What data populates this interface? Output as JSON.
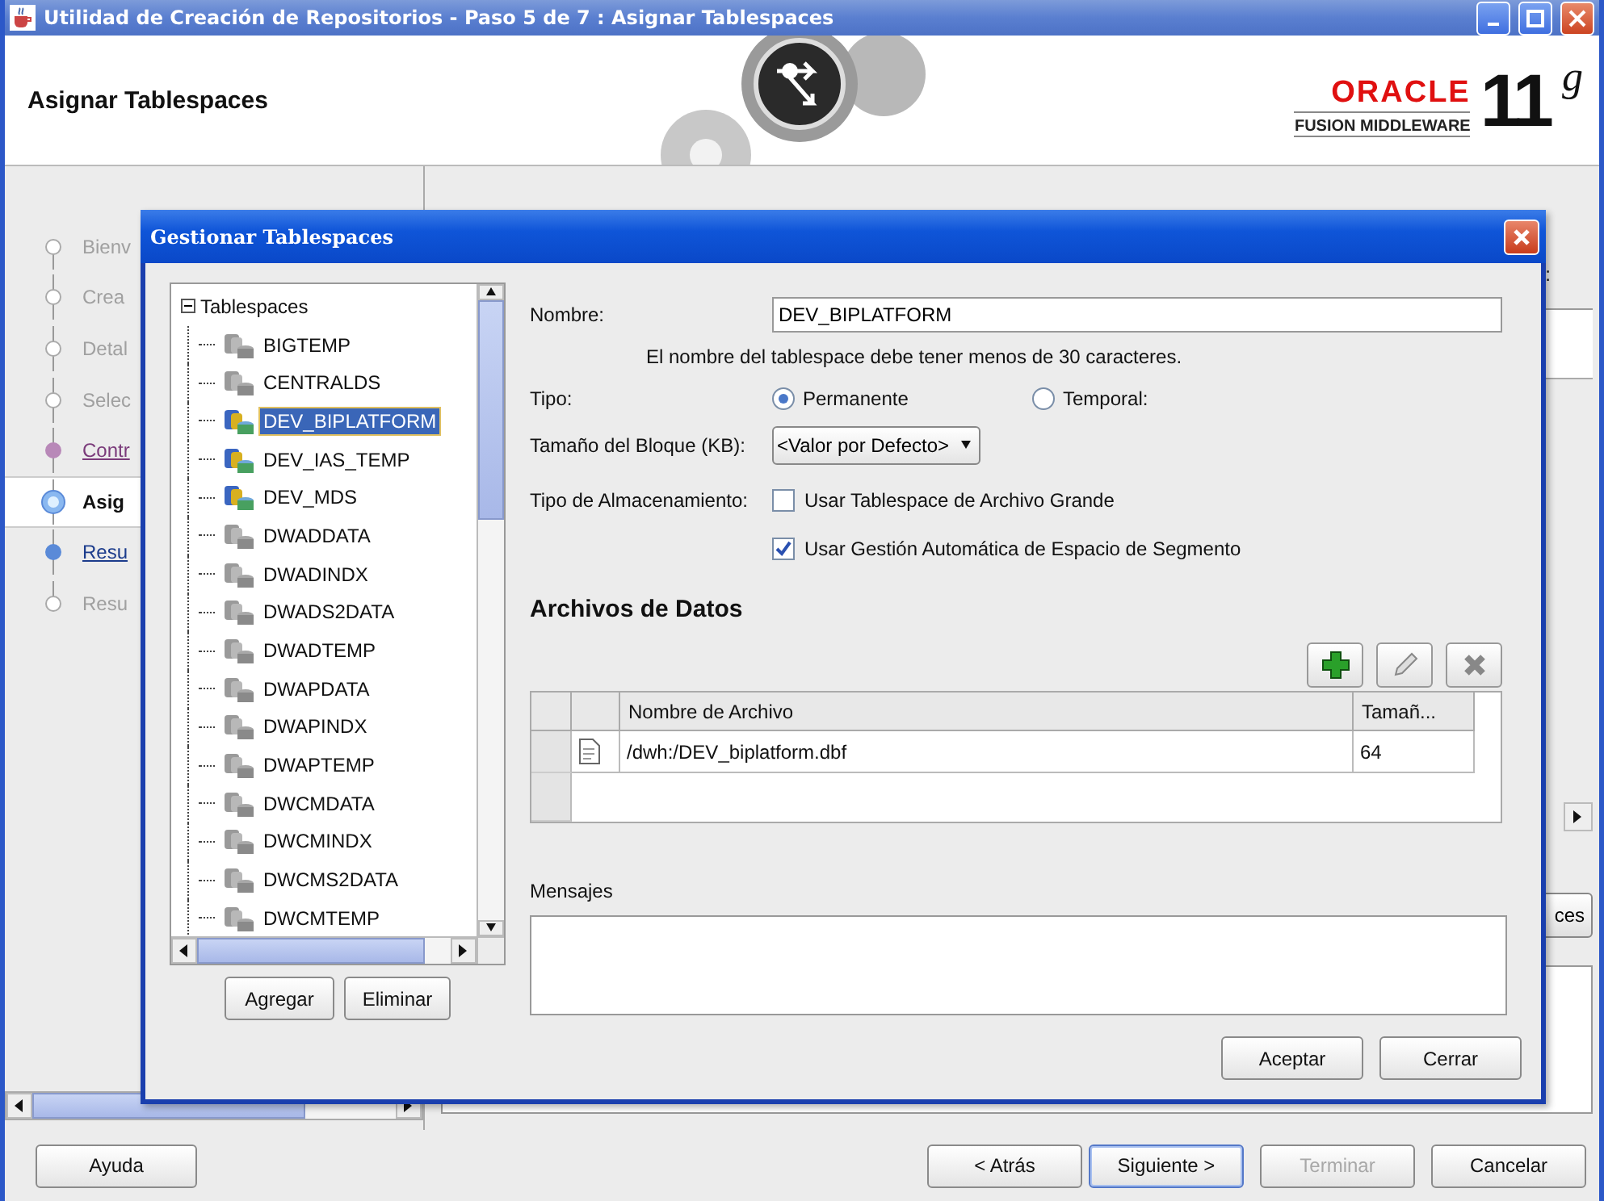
{
  "window": {
    "title": "Utilidad de Creación de Repositorios - Paso 5 de 7 : Asignar Tablespaces"
  },
  "header": {
    "title": "Asignar Tablespaces",
    "logo": {
      "brand": "ORACLE",
      "product": "FUSION MIDDLEWARE",
      "version": "11",
      "version_suffix": "g"
    }
  },
  "steps": [
    {
      "label": "Bienv",
      "kind": "done",
      "selected": false
    },
    {
      "label": "Crea",
      "kind": "done",
      "selected": false
    },
    {
      "label": "Detal",
      "kind": "done",
      "selected": false
    },
    {
      "label": "Selec",
      "kind": "done",
      "selected": false
    },
    {
      "label": "Contr",
      "kind": "visited",
      "selected": false
    },
    {
      "label": "Asig",
      "kind": "current",
      "selected": true
    },
    {
      "label": "Resu",
      "kind": "link",
      "selected": false
    },
    {
      "label": "Resu",
      "kind": "pending",
      "selected": false
    }
  ],
  "background": {
    "text_fragment": ":",
    "button_fragment": "ces"
  },
  "dialog": {
    "title": "Gestionar Tablespaces",
    "tree": {
      "label": "Tablespaces",
      "expanded": true,
      "children": [
        {
          "label": "BIGTEMP",
          "in_use": false,
          "selected": false
        },
        {
          "label": "CENTRALDS",
          "in_use": false,
          "selected": false
        },
        {
          "label": "DEV_BIPLATFORM",
          "in_use": true,
          "selected": true
        },
        {
          "label": "DEV_IAS_TEMP",
          "in_use": true,
          "selected": false
        },
        {
          "label": "DEV_MDS",
          "in_use": true,
          "selected": false
        },
        {
          "label": "DWADDATA",
          "in_use": false,
          "selected": false
        },
        {
          "label": "DWADINDX",
          "in_use": false,
          "selected": false
        },
        {
          "label": "DWADS2DATA",
          "in_use": false,
          "selected": false
        },
        {
          "label": "DWADTEMP",
          "in_use": false,
          "selected": false
        },
        {
          "label": "DWAPDATA",
          "in_use": false,
          "selected": false
        },
        {
          "label": "DWAPINDX",
          "in_use": false,
          "selected": false
        },
        {
          "label": "DWAPTEMP",
          "in_use": false,
          "selected": false
        },
        {
          "label": "DWCMDATA",
          "in_use": false,
          "selected": false
        },
        {
          "label": "DWCMINDX",
          "in_use": false,
          "selected": false
        },
        {
          "label": "DWCMS2DATA",
          "in_use": false,
          "selected": false
        },
        {
          "label": "DWCMTEMP",
          "in_use": false,
          "selected": false
        }
      ]
    },
    "tree_buttons": [
      "Agregar",
      "Eliminar"
    ],
    "name": {
      "label": "Nombre:",
      "value": "DEV_BIPLATFORM",
      "hint": "El nombre del tablespace debe tener menos de 30 caracteres."
    },
    "type": {
      "label": "Tipo:",
      "options": [
        {
          "label": "Permanente",
          "selected": true
        },
        {
          "label": "Temporal:",
          "selected": false
        }
      ]
    },
    "block_size": {
      "label": "Tamaño del Bloque (KB):",
      "value": "<Valor por Defecto>"
    },
    "storage": {
      "label": "Tipo de Almacenamiento:",
      "options": [
        {
          "label": "Usar Tablespace de Archivo Grande",
          "checked": false
        },
        {
          "label": "Usar Gestión Automática de Espacio de Segmento",
          "checked": true
        }
      ]
    },
    "datafiles": {
      "title": "Archivos de Datos",
      "columns": [
        "Nombre de Archivo",
        "Tamañ..."
      ],
      "rows": [
        {
          "cells": [
            "/dwh:/DEV_biplatform.dbf",
            "64"
          ]
        }
      ]
    },
    "messages": {
      "label": "Mensajes"
    },
    "buttons": [
      "Aceptar",
      "Cerrar"
    ]
  },
  "buttons": [
    {
      "label": "Ayuda",
      "kind": "help",
      "disabled": false,
      "default": false
    },
    {
      "label": "< Atrás",
      "kind": "nav",
      "disabled": false,
      "default": false
    },
    {
      "label": "Siguiente >",
      "kind": "nav",
      "disabled": false,
      "default": true
    },
    {
      "label": "Terminar",
      "kind": "nav",
      "disabled": true,
      "default": false
    },
    {
      "label": "Cancelar",
      "kind": "nav",
      "disabled": false,
      "default": false
    }
  ]
}
